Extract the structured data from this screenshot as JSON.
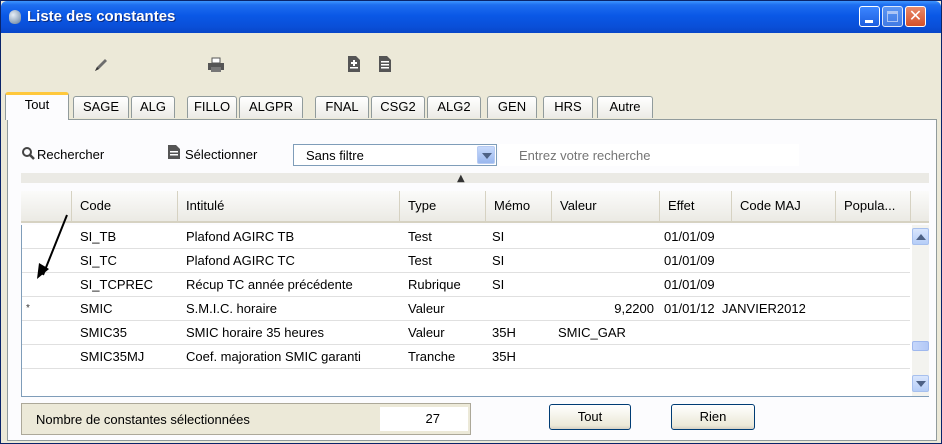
{
  "window": {
    "title": "Liste des constantes"
  },
  "tabs": [
    "Tout",
    "SAGE",
    "ALG",
    "FILLO",
    "ALGPR",
    "FNAL",
    "CSG2",
    "ALG2",
    "GEN",
    "HRS",
    "Autre"
  ],
  "search": {
    "find_label": "Rechercher",
    "select_label": "Sélectionner",
    "filter_value": "Sans filtre",
    "input_placeholder": "Entrez votre recherche"
  },
  "grid": {
    "columns": [
      "Code",
      "Intitulé",
      "Type",
      "Mémo",
      "Valeur",
      "Effet",
      "Code MAJ",
      "Popula..."
    ],
    "rows": [
      {
        "mark": "",
        "code": "SI_TB",
        "intitule": "Plafond AGIRC TB",
        "type": "Test",
        "memo": "SI",
        "valeur": "",
        "effet": "01/01/09",
        "code_maj": ""
      },
      {
        "mark": "",
        "code": "SI_TC",
        "intitule": "Plafond AGIRC TC",
        "type": "Test",
        "memo": "SI",
        "valeur": "",
        "effet": "01/01/09",
        "code_maj": ""
      },
      {
        "mark": "",
        "code": "SI_TCPREC",
        "intitule": "Récup TC année précédente",
        "type": "Rubrique",
        "memo": "SI",
        "valeur": "",
        "effet": "01/01/09",
        "code_maj": ""
      },
      {
        "mark": "*",
        "code": "SMIC",
        "intitule": "S.M.I.C. horaire",
        "type": "Valeur",
        "memo": "",
        "valeur": "9,2200",
        "effet": "01/01/12",
        "code_maj": "JANVIER2012"
      },
      {
        "mark": "",
        "code": "SMIC35",
        "intitule": "SMIC horaire 35 heures",
        "type": "Valeur",
        "memo": "35H",
        "valeur": "SMIC_GAR",
        "effet": "",
        "code_maj": ""
      },
      {
        "mark": "",
        "code": "SMIC35MJ",
        "intitule": "Coef. majoration SMIC garanti",
        "type": "Tranche",
        "memo": "35H",
        "valeur": "",
        "effet": "",
        "code_maj": ""
      }
    ]
  },
  "footer": {
    "count_label": "Nombre de constantes sélectionnées",
    "count_value": "27",
    "tout_button": "Tout",
    "rien_button": "Rien"
  }
}
